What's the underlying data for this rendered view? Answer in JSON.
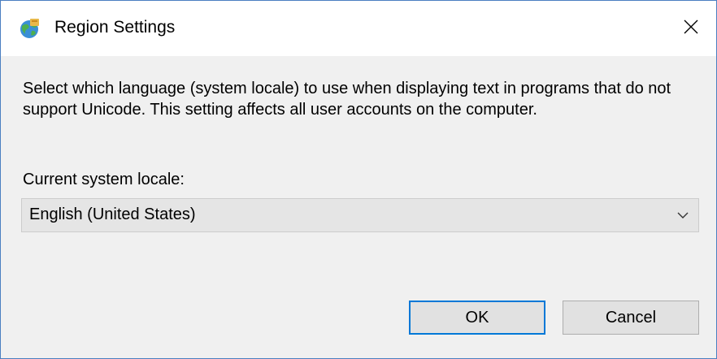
{
  "window": {
    "title": "Region Settings",
    "icon": "globe-region-icon",
    "close_icon": "close-icon"
  },
  "content": {
    "description": "Select which language (system locale) to use when displaying text in programs that do not support Unicode. This setting affects all user accounts on the computer.",
    "locale_label": "Current system locale:",
    "locale_value": "English (United States)",
    "dropdown_icon": "chevron-down-icon"
  },
  "buttons": {
    "ok_label": "OK",
    "cancel_label": "Cancel"
  },
  "colors": {
    "window_border": "#4a7fc1",
    "focus_accent": "#0078d7",
    "dialog_background": "#f0f0f0"
  }
}
